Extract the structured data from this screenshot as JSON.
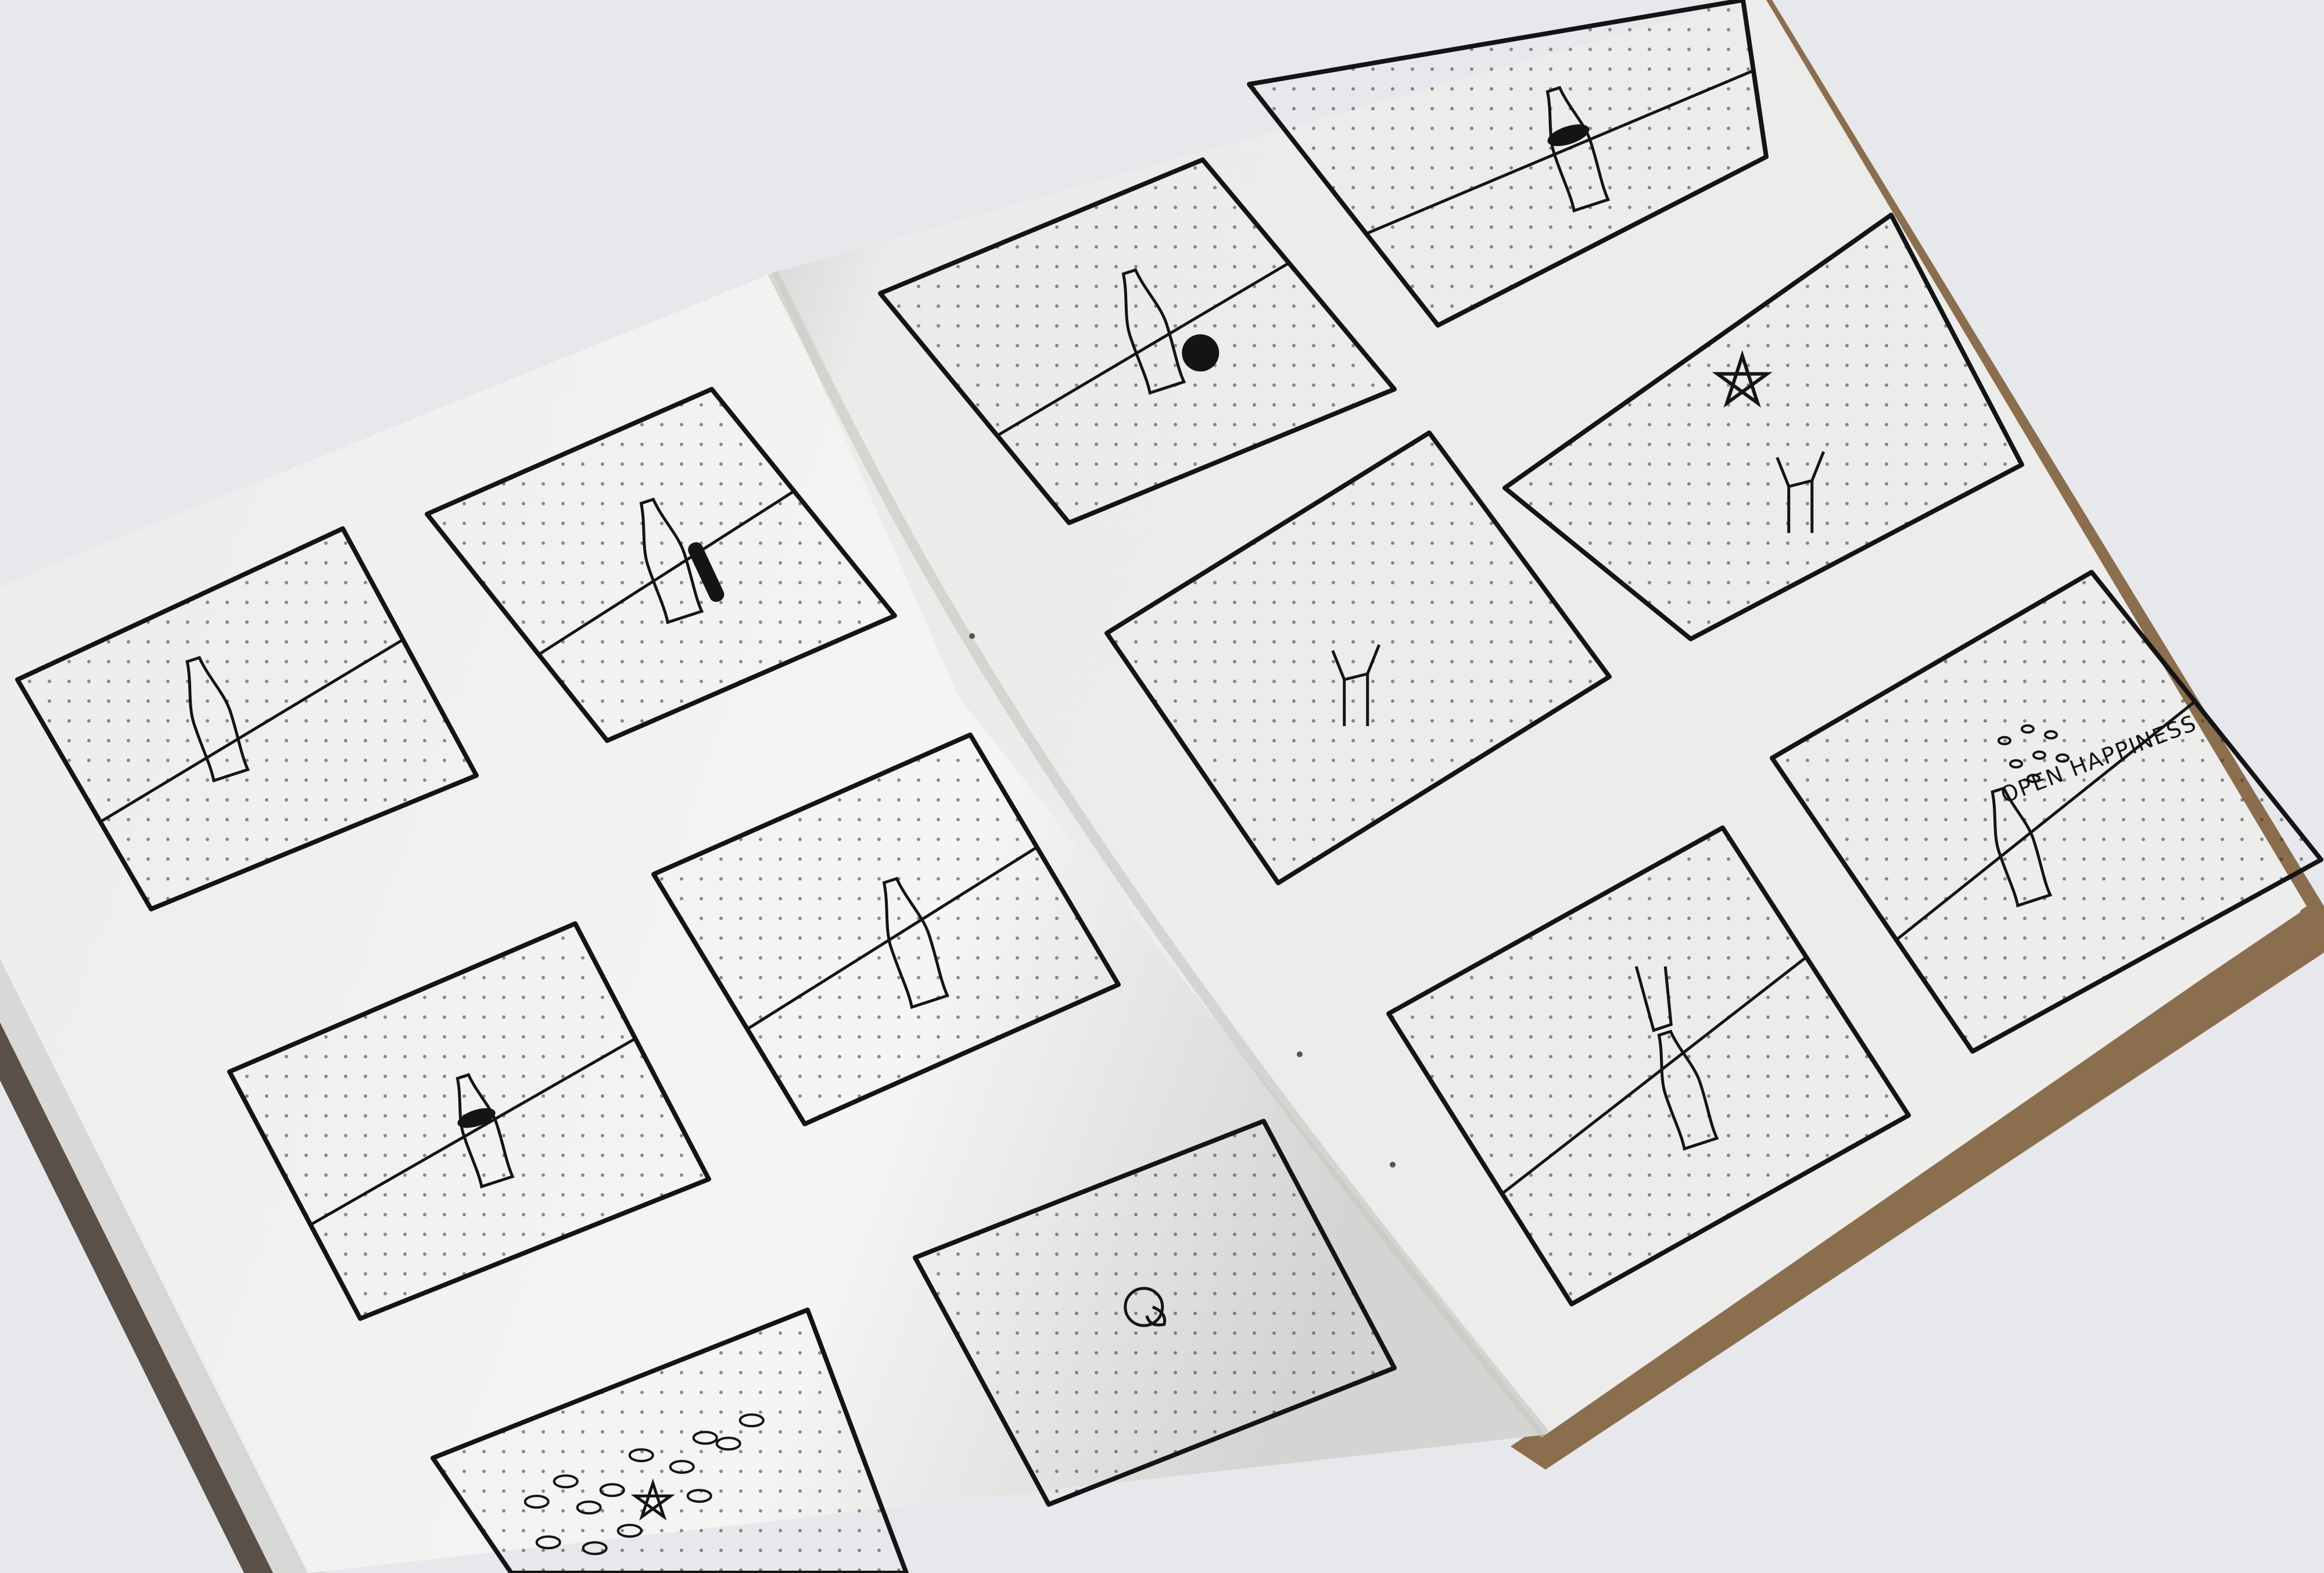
{
  "scene": {
    "colors": {
      "table": "#e7e8ec",
      "paper": "#f3f3f1",
      "paper_shadow": "#d9d9d7",
      "cover": "#8b6e4e",
      "ink": "#141414"
    }
  },
  "frames": [
    {
      "name": "frame-bottle-standing",
      "content": "bottle-on-horizon"
    },
    {
      "name": "frame-bottle-hand-grab",
      "content": "bottle-with-hand"
    },
    {
      "name": "frame-bottle-rotating",
      "content": "bottle-dark-band"
    },
    {
      "name": "frame-bottle-lifted",
      "content": "bottle-lifted"
    },
    {
      "name": "frame-bubbles-star",
      "content": "bubbles-and-star"
    },
    {
      "name": "frame-bottle-cap",
      "content": "cap-swirl"
    },
    {
      "name": "frame-bottle-ball",
      "content": "bottle-and-ball"
    },
    {
      "name": "frame-bottle-cap-off",
      "content": "bottle-cap-removed"
    },
    {
      "name": "frame-figure-cheer",
      "content": "figure-arms-up"
    },
    {
      "name": "frame-star-figure",
      "content": "star-and-figure"
    },
    {
      "name": "frame-hand-bottle",
      "content": "hand-over-bottle"
    },
    {
      "name": "frame-open-happiness",
      "content": "bottle-with-slogan"
    }
  ],
  "slogan": "OPEN HAPPINESS"
}
